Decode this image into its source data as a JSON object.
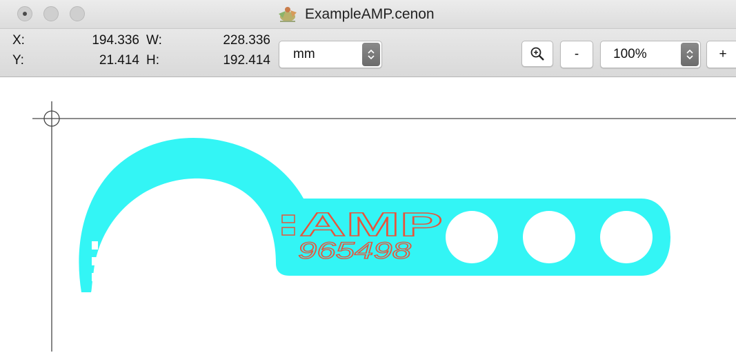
{
  "window": {
    "title": "ExampleAMP.cenon",
    "title_icon": "cenon-app-icon"
  },
  "toolbar": {
    "x_label": "X:",
    "x_value": "194.336",
    "y_label": "Y:",
    "y_value": "21.414",
    "w_label": "W:",
    "w_value": "228.336",
    "h_label": "H:",
    "h_value": "192.414",
    "unit_selected": "mm",
    "zoom_icon": "magnifier-plus-icon",
    "zoom_out_label": "-",
    "zoom_value": "100%",
    "zoom_in_label": "+"
  },
  "drawing": {
    "logo_text": "AMP",
    "part_number": "965498",
    "part_fill": "#33f5f5",
    "text_stroke": "#e8533a"
  }
}
